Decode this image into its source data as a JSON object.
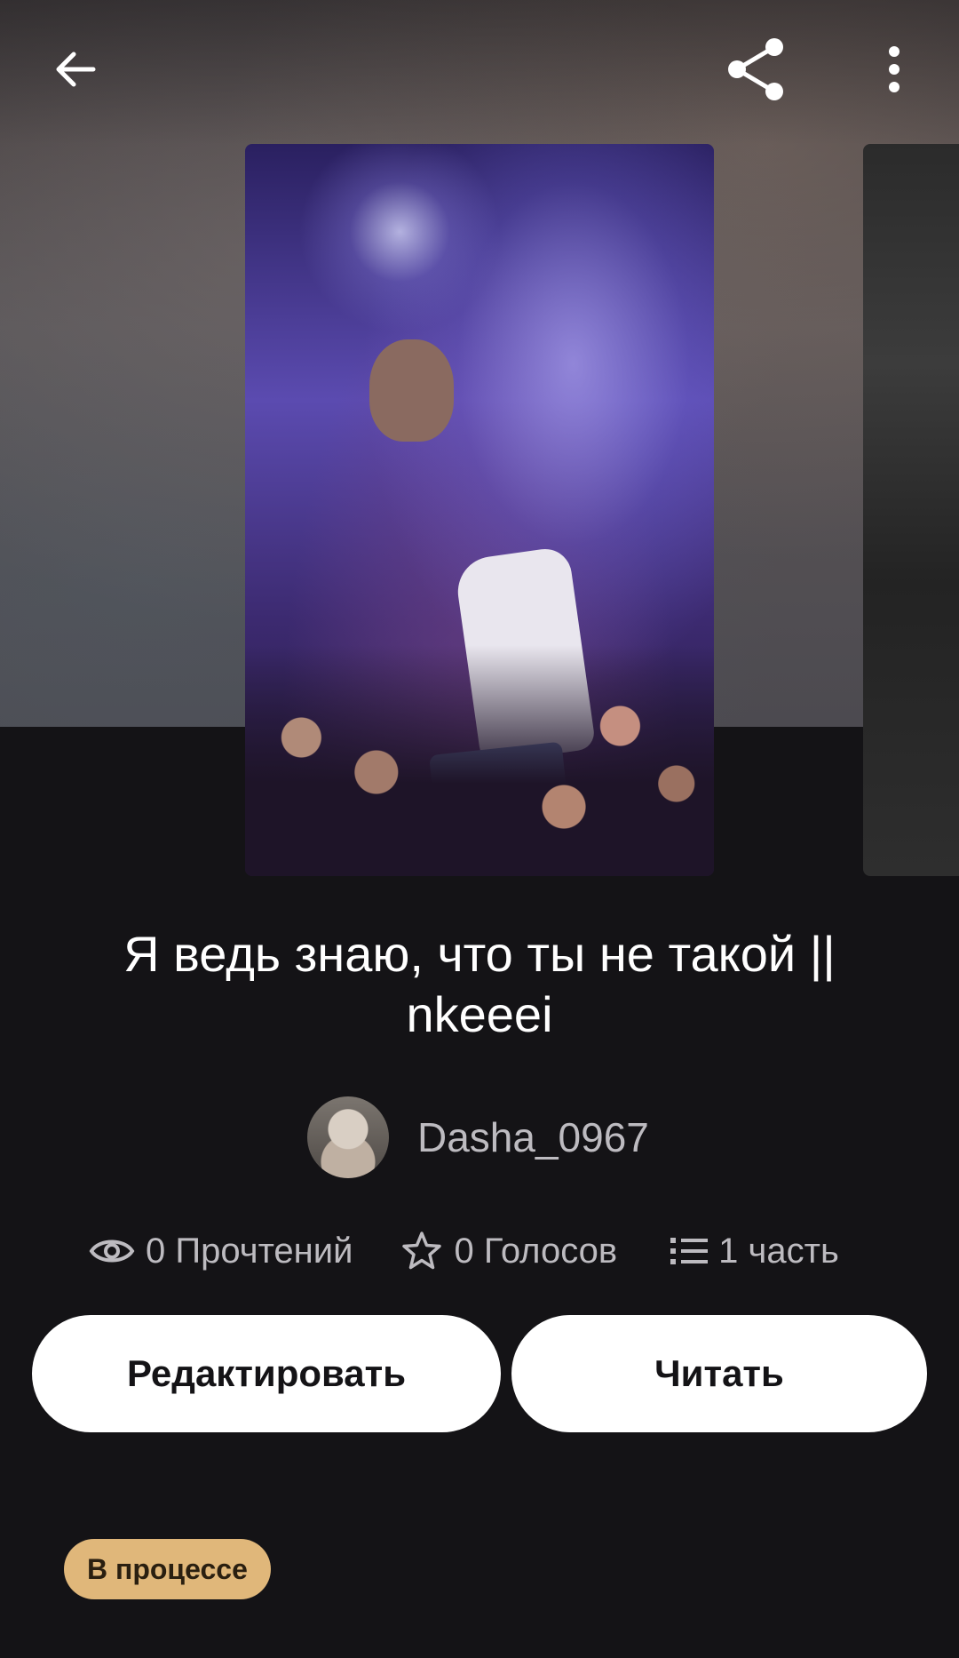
{
  "header": {
    "icons": {
      "back": "arrow-left-icon",
      "share": "share-icon",
      "more": "more-vertical-icon"
    }
  },
  "story": {
    "title": "Я ведь знаю, что ты не такой || nkeeei",
    "author": "Dasha_0967",
    "status": "В процессе"
  },
  "stats": {
    "reads": "0 Прочтений",
    "votes": "0 Голосов",
    "parts": "1 часть"
  },
  "actions": {
    "edit_label": "Редактировать",
    "read_label": "Читать"
  },
  "colors": {
    "background": "#141316",
    "button_bg": "#ffffff",
    "status_badge": "#e0b77a",
    "secondary_text": "#bdbbc0"
  }
}
